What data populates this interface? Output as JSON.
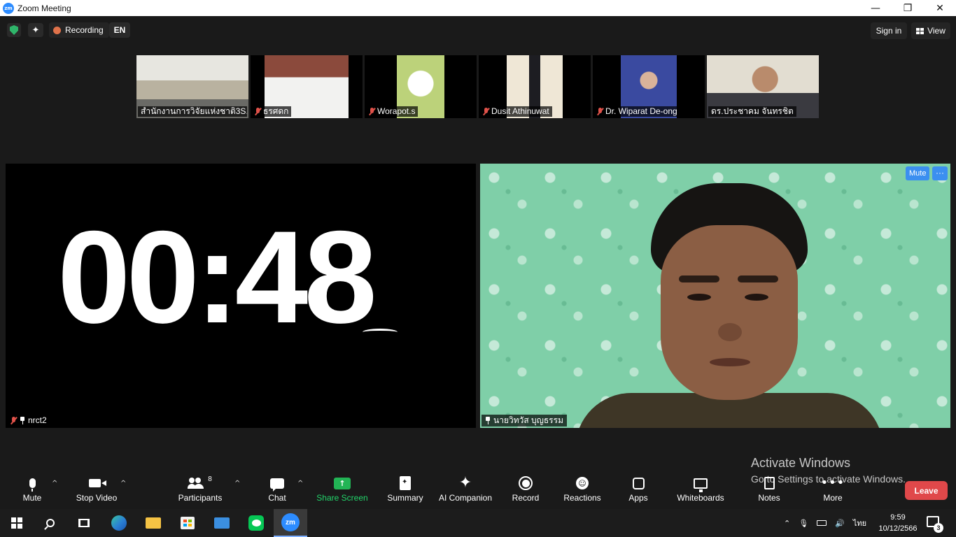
{
  "window": {
    "title": "Zoom Meeting",
    "app_icon_text": "zm",
    "controls": {
      "minimize": "—",
      "restore": "❐",
      "close": "✕"
    }
  },
  "top_bar": {
    "recording_label": "Recording",
    "language": "EN",
    "sign_in": "Sign in",
    "view": "View"
  },
  "thumbnails": [
    {
      "name": "สำนักงานการวิจัยแห่งชาติ3S...",
      "muted": false,
      "active": false,
      "bg": "#c7c9c2"
    },
    {
      "name": "ธรศดก",
      "muted": true,
      "active": false,
      "bg": "#b07a60"
    },
    {
      "name": "Worapot.s",
      "muted": true,
      "active": false,
      "bg": "#c9d89a"
    },
    {
      "name": "Dusit Athinuwat",
      "muted": true,
      "active": false,
      "bg": "#e8dfcf"
    },
    {
      "name": "Dr. Wiparat De-ong",
      "muted": true,
      "active": false,
      "bg": "#4a55a8"
    },
    {
      "name": "ดร.ประชาคม จันทรชิต",
      "muted": false,
      "active": true,
      "bg": "#d7d2c5"
    }
  ],
  "main_tiles": {
    "left": {
      "timer": "00:48",
      "name": "nrct2",
      "muted": true
    },
    "right": {
      "name": "นายวิทวัส บุญธรรม",
      "mute_button": "Mute",
      "more_button": "···"
    }
  },
  "watermark": {
    "line1": "Activate Windows",
    "line2": "Go to Settings to activate Windows."
  },
  "toolbar": {
    "mute": "Mute",
    "stop_video": "Stop Video",
    "participants": "Participants",
    "participants_count": "8",
    "chat": "Chat",
    "share_screen": "Share Screen",
    "summary": "Summary",
    "ai_companion": "AI Companion",
    "record": "Record",
    "reactions": "Reactions",
    "apps": "Apps",
    "whiteboards": "Whiteboards",
    "notes": "Notes",
    "more": "More",
    "leave": "Leave",
    "caret": "^"
  },
  "taskbar": {
    "zoom_icon_text": "zm",
    "tray_lang": "ไทย",
    "time": "9:59",
    "date": "10/12/2566",
    "notification_count": "3"
  },
  "colors": {
    "accent": "#2d8cff",
    "share_green": "#22b455",
    "leave_red": "#e0484a",
    "active_border": "#e8e35a"
  }
}
